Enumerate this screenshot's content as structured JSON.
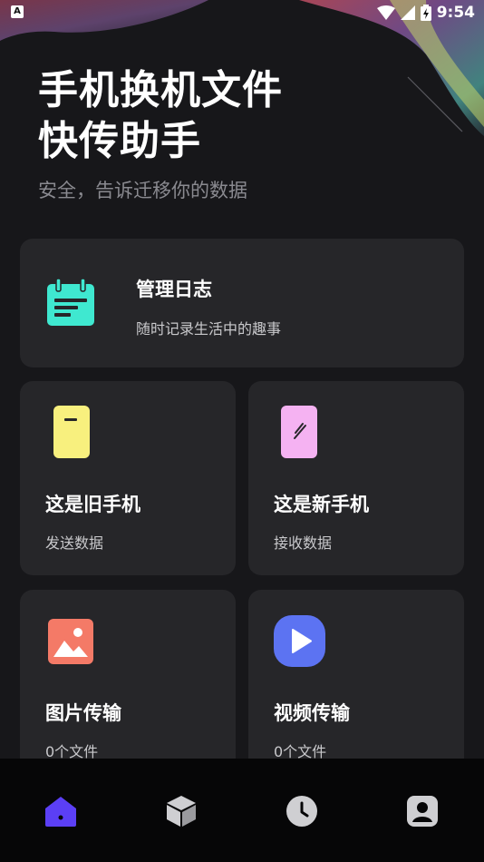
{
  "status_bar": {
    "time": "9:54",
    "left_badge": "A"
  },
  "hero": {
    "title": "手机换机文件\n快传助手",
    "subtitle": "安全，告诉迁移你的数据"
  },
  "cards": {
    "log": {
      "title": "管理日志",
      "subtitle": "随时记录生活中的趣事",
      "icon": "calendar-icon",
      "color": "#3fe8d0"
    },
    "old_phone": {
      "title": "这是旧手机",
      "subtitle": "发送数据",
      "icon": "old-phone-icon",
      "color": "#f8f07e"
    },
    "new_phone": {
      "title": "这是新手机",
      "subtitle": "接收数据",
      "icon": "new-phone-icon",
      "color": "#f5b2f2"
    },
    "image_transfer": {
      "title": "图片传输",
      "subtitle": "0个文件",
      "icon": "image-icon",
      "color": "#f47a67"
    },
    "video_transfer": {
      "title": "视频传输",
      "subtitle": "0个文件",
      "icon": "play-icon",
      "color": "#5c73f2"
    }
  },
  "bottom_nav": {
    "items": [
      {
        "icon": "home-icon",
        "active": true
      },
      {
        "icon": "box-icon",
        "active": false
      },
      {
        "icon": "clock-icon",
        "active": false
      },
      {
        "icon": "profile-icon",
        "active": false
      }
    ],
    "active_color": "#5b3ff5",
    "inactive_color": "#cfcfd2"
  }
}
